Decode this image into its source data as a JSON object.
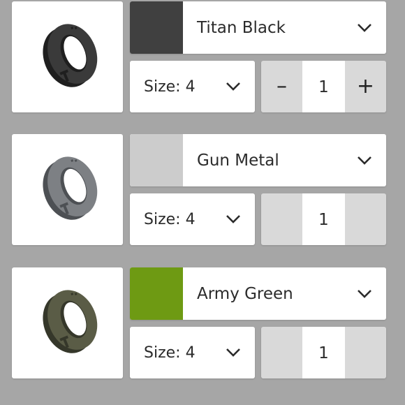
{
  "items": [
    {
      "color_name": "Titan Black",
      "swatch_color": "#404040",
      "ring_color": "#3a3a3a",
      "ring_dark": "#1f1f1f",
      "size_label": "Size: 4",
      "quantity": "1",
      "minus_label": "–",
      "plus_label": "+"
    },
    {
      "color_name": "Gun Metal",
      "swatch_color": "#cccccc",
      "ring_color": "#7d8084",
      "ring_dark": "#4d5054",
      "size_label": "Size: 4",
      "quantity": "1",
      "minus_label": "",
      "plus_label": ""
    },
    {
      "color_name": "Army Green",
      "swatch_color": "#6e9a13",
      "ring_color": "#5a5c46",
      "ring_dark": "#35372a",
      "size_label": "Size: 4",
      "quantity": "1",
      "minus_label": "",
      "plus_label": ""
    }
  ]
}
